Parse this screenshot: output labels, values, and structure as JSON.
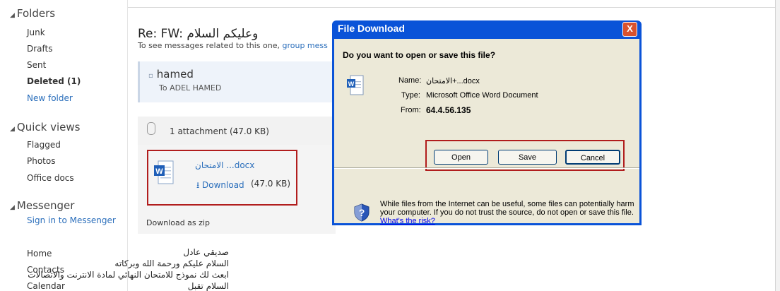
{
  "sidebar": {
    "folders_title": "Folders",
    "folders": [
      {
        "label": "Junk"
      },
      {
        "label": "Drafts"
      },
      {
        "label": "Sent"
      },
      {
        "label": "Deleted (1)"
      },
      {
        "label": "New folder"
      }
    ],
    "quickviews_title": "Quick views",
    "quickviews": [
      {
        "label": "Flagged"
      },
      {
        "label": "Photos"
      },
      {
        "label": "Office docs"
      }
    ],
    "messenger_title": "Messenger",
    "messenger_link": "Sign in to Messenger",
    "bottom": [
      {
        "label": "Home"
      },
      {
        "label": "Contacts"
      },
      {
        "label": "Calendar"
      }
    ]
  },
  "message": {
    "subject": "Re: FW: وعليكم السلام",
    "related_text": "To see messages related to this one, ",
    "related_link": "group mess",
    "sender": "hamed",
    "to": "To ADEL HAMED",
    "attachment_count": "1 attachment (47.0 KB)",
    "file_name": "الامتحان ...docx",
    "download_label": "Download",
    "download_size": "(47.0 KB)",
    "download_zip": "Download as zip",
    "body_lines": [
      "صديقي عادل",
      "السلام عليكم ورحمة الله وبركاته",
      "ابعث لك نموذج للامتحان النهائي لمادة الانترنت والاتصالات",
      "السلام تقبل"
    ]
  },
  "dialog": {
    "title": "File Download",
    "close": "X",
    "question": "Do you want to open or save this file?",
    "name_label": "Name:",
    "name_value": "الامتحان+...docx",
    "type_label": "Type:",
    "type_value": "Microsoft Office Word Document",
    "from_label": "From:",
    "from_value": "64.4.56.135",
    "open_btn": "Open",
    "save_btn": "Save",
    "cancel_btn": "Cancel",
    "warning": "While files from the Internet can be useful, some files can potentially harm your computer. If you do not trust the source, do not open or save this file. ",
    "risk_link": "What's the risk?"
  },
  "colors": {
    "link": "#2a6ebb",
    "dialog_title_bar": "#0a53d8",
    "dialog_body": "#ece9d8",
    "highlight_box": "#b11d1d"
  }
}
